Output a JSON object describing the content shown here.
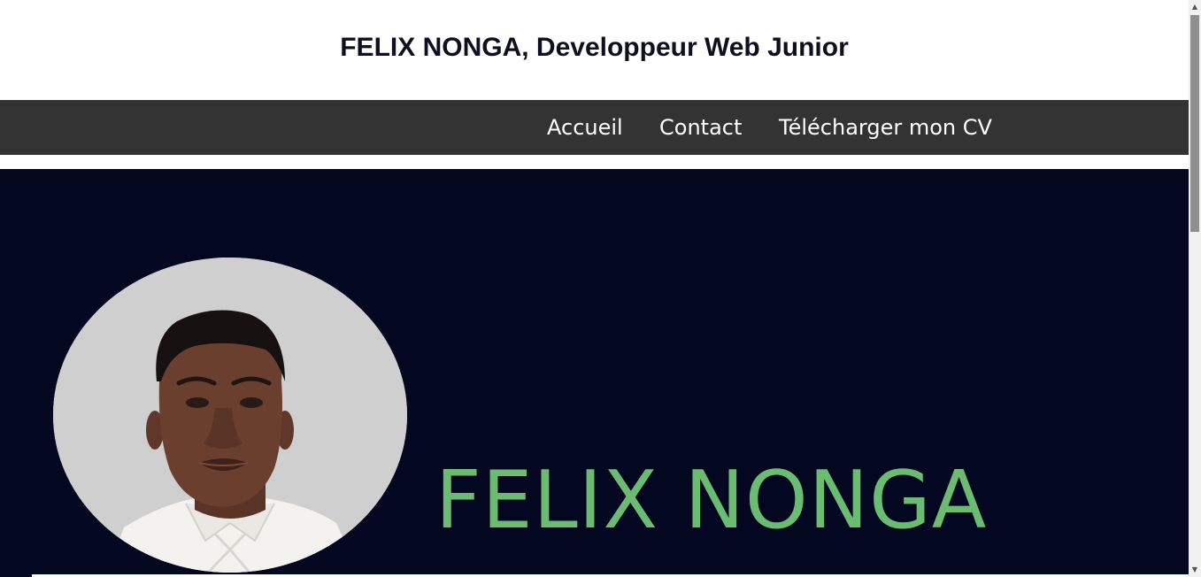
{
  "header": {
    "title": "FELIX NONGA, Developpeur Web Junior"
  },
  "nav": {
    "items": [
      {
        "label": "Accueil"
      },
      {
        "label": "Contact"
      },
      {
        "label": "Télécharger mon CV"
      }
    ]
  },
  "hero": {
    "name": "FELIX NONGA",
    "photo_icon": "profile-photo",
    "name_color": "#6bbb72",
    "background_color": "#030720"
  },
  "colors": {
    "nav_background": "#333333",
    "title_color": "#0f0f1f",
    "avatar_background": "#cfcfcf"
  },
  "scrollbar": {
    "up_arrow": "▲",
    "down_arrow": "▼"
  }
}
